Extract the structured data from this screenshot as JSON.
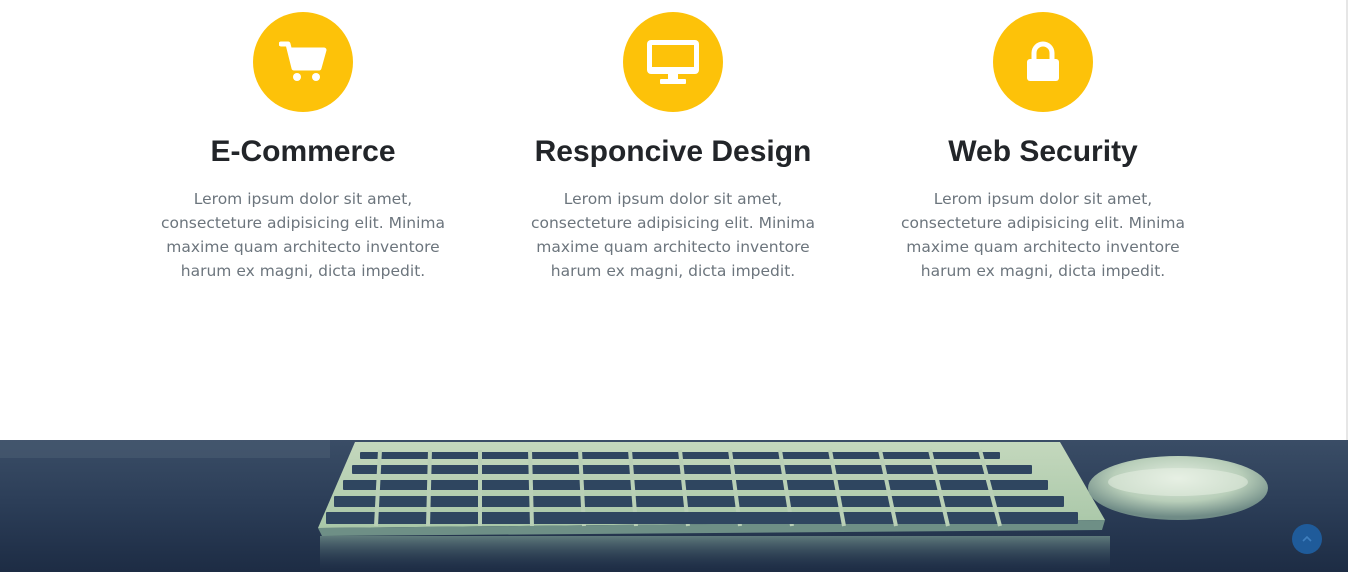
{
  "services": [
    {
      "icon": "cart-icon",
      "title": "E-Commerce",
      "description": "Lerom ipsum dolor sit amet, consecteture adipisicing elit. Minima maxime quam architecto inventore harum ex magni, dicta impedit."
    },
    {
      "icon": "monitor-icon",
      "title": "Responcive Design",
      "description": "Lerom ipsum dolor sit amet, consecteture adipisicing elit. Minima maxime quam architecto inventore harum ex magni, dicta impedit."
    },
    {
      "icon": "lock-icon",
      "title": "Web Security",
      "description": "Lerom ipsum dolor sit amet, consecteture adipisicing elit. Minima maxime quam architecto inventore harum ex magni, dicta impedit."
    }
  ],
  "colors": {
    "accent": "#fdc209",
    "heading": "#222529",
    "body_text": "#6c757d",
    "hero_bg": "#24344f",
    "scroll_top_bg": "#1f5b9a"
  },
  "hero": {
    "image": "keyboard-and-mouse-photo"
  },
  "scroll_top": {
    "icon": "chevron-up-icon"
  }
}
